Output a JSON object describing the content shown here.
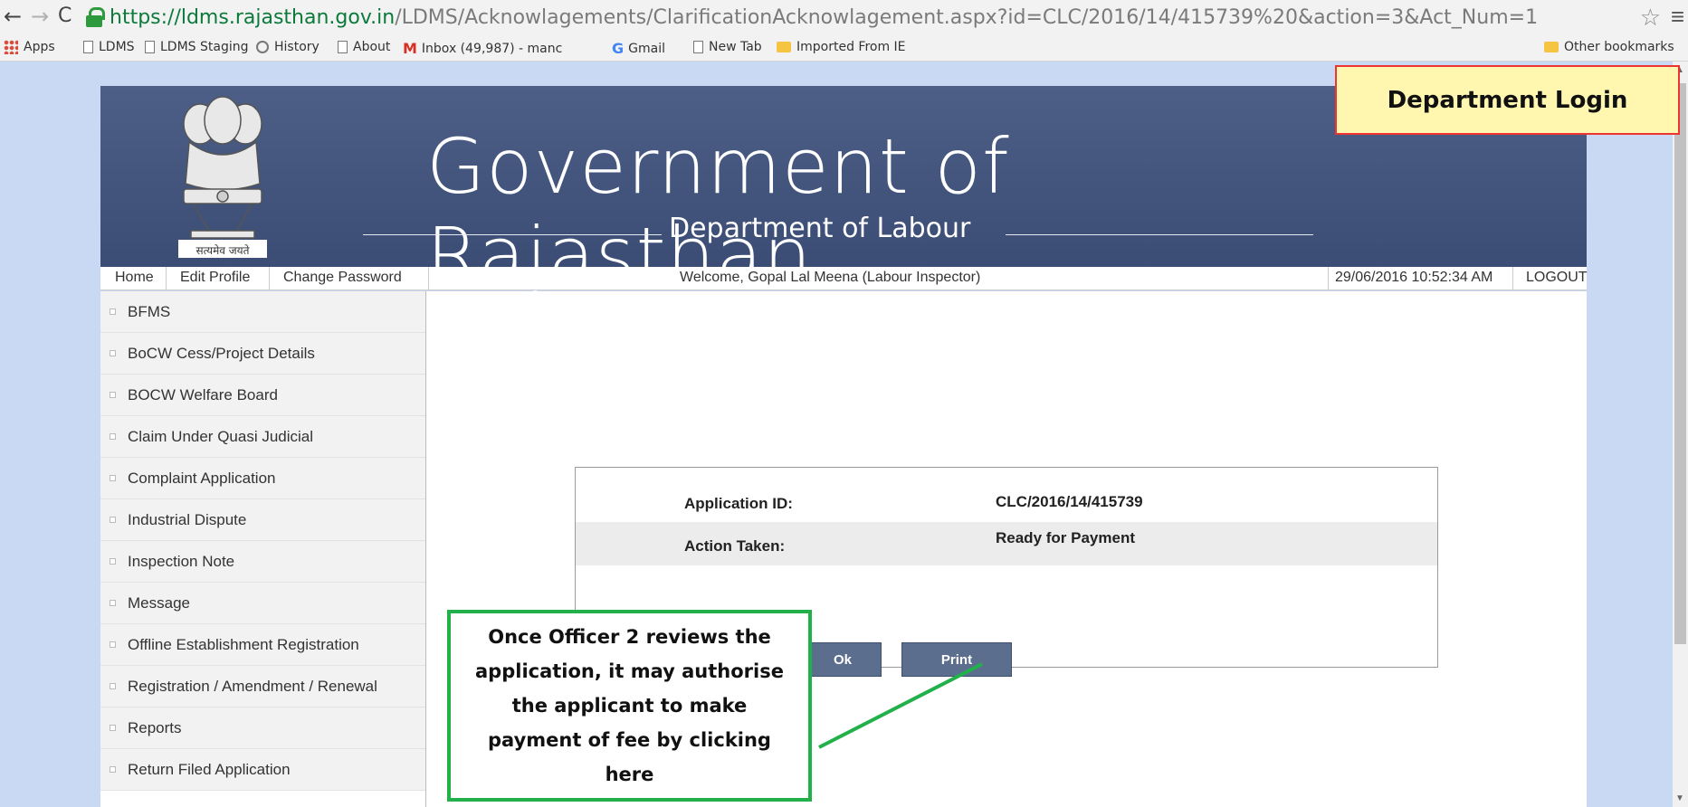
{
  "browser": {
    "url_host": "https://ldms.rajasthan.gov.in",
    "url_path": "/LDMS/Acknowlagements/ClarificationAcknowlagement.aspx?id=CLC/2016/14/415739%20&action=3&Act_Num=1",
    "bookmarks": [
      "Apps",
      "LDMS",
      "LDMS Staging",
      "History",
      "About",
      "Inbox (49,987) - manc",
      "Gmail",
      "New Tab",
      "Imported From IE"
    ],
    "other_bookmarks": "Other bookmarks"
  },
  "header": {
    "title": "Government of Rajasthan",
    "subtitle": "Department of Labour",
    "emblem_motto": "सत्यमेव जयते"
  },
  "topbar": {
    "home": "Home",
    "edit_profile": "Edit Profile",
    "change_password": "Change Password",
    "welcome": "Welcome, Gopal Lal Meena (Labour Inspector)",
    "datetime": "29/06/2016 10:52:34 AM",
    "logout": "LOGOUT"
  },
  "sidebar": {
    "items": [
      {
        "label": "BFMS"
      },
      {
        "label": "BoCW Cess/Project Details"
      },
      {
        "label": "BOCW Welfare Board"
      },
      {
        "label": "Claim Under Quasi Judicial"
      },
      {
        "label": "Complaint Application"
      },
      {
        "label": "Industrial Dispute"
      },
      {
        "label": "Inspection Note"
      },
      {
        "label": "Message"
      },
      {
        "label": "Offline Establishment Registration"
      },
      {
        "label": "Registration / Amendment / Renewal"
      },
      {
        "label": "Reports"
      },
      {
        "label": "Return Filed Application"
      }
    ]
  },
  "acknowledgement": {
    "app_id_label": "Application ID:",
    "app_id_value": "CLC/2016/14/415739",
    "action_label": "Action Taken:",
    "action_value": "Ready for Payment",
    "ok_label": "Ok",
    "print_label": "Print"
  },
  "annotations": {
    "dept_login": "Department Login",
    "callout": "Once Officer 2 reviews the application, it may authorise the applicant to make payment of fee by clicking here"
  },
  "colors": {
    "header_band": "#4d5f87",
    "button": "#5c6e8e",
    "callout_border": "#22b04b",
    "login_border": "#ee3333"
  }
}
